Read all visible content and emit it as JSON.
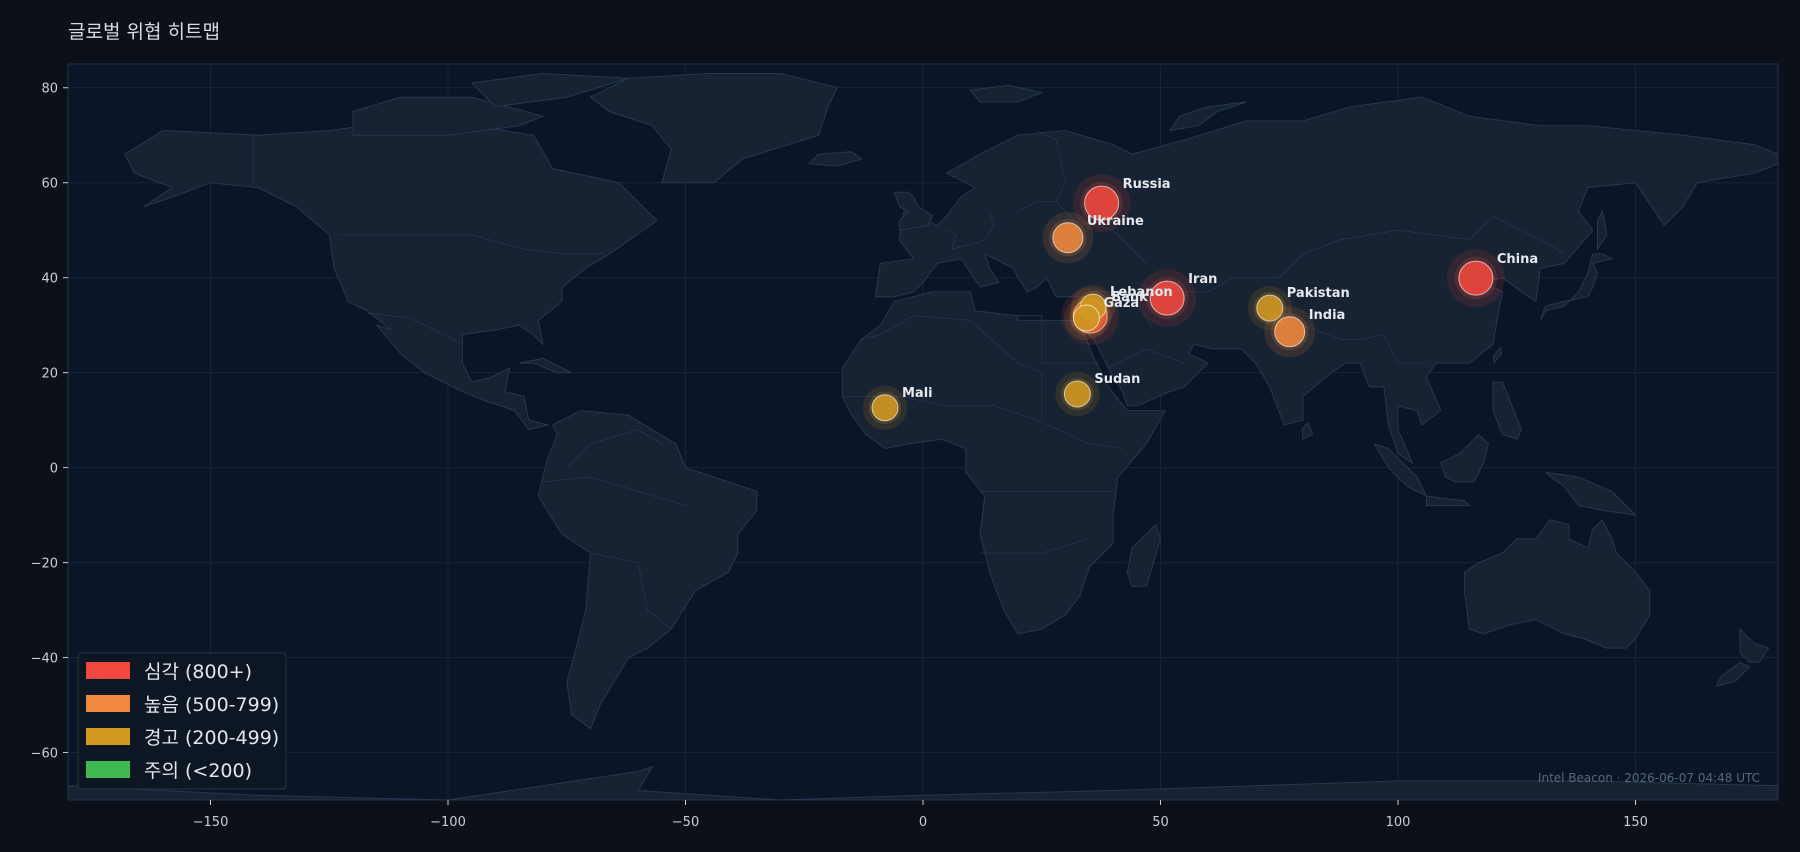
{
  "title": "글로벌 위협 히트맵",
  "credit": "Intel Beacon · 2026-06-07 04:48 UTC",
  "colors": {
    "critical": "#f0483e",
    "high": "#f0883e",
    "warning": "#d29922",
    "caution": "#3fb950",
    "background": "#0c1018",
    "ocean": "#0a1628",
    "land": "#172232"
  },
  "legend": [
    {
      "label": "심각 (800+)",
      "color": "#f0483e"
    },
    {
      "label": "높음 (500-799)",
      "color": "#f0883e"
    },
    {
      "label": "경고 (200-499)",
      "color": "#d29922"
    },
    {
      "label": "주의 (<200)",
      "color": "#3fb950"
    }
  ],
  "chart_data": {
    "type": "scatter",
    "xlim": [
      -180,
      180
    ],
    "ylim": [
      -70,
      85
    ],
    "xticks": [
      -150,
      -100,
      -50,
      0,
      50,
      100,
      150
    ],
    "yticks": [
      80,
      60,
      40,
      20,
      0,
      -20,
      -40,
      -60
    ],
    "grid": true,
    "legend_position": "lower-left",
    "points": [
      {
        "name": "Russia",
        "lon": 37.6,
        "lat": 55.7,
        "level": "critical"
      },
      {
        "name": "Ukraine",
        "lon": 30.5,
        "lat": 48.4,
        "level": "high"
      },
      {
        "name": "China",
        "lon": 116.4,
        "lat": 39.9,
        "level": "critical"
      },
      {
        "name": "Iran",
        "lon": 51.4,
        "lat": 35.7,
        "level": "critical"
      },
      {
        "name": "Bank",
        "lon": 35.2,
        "lat": 31.9,
        "level": "critical"
      },
      {
        "name": "Lebanon",
        "lon": 35.8,
        "lat": 33.8,
        "level": "warning"
      },
      {
        "name": "Gaza",
        "lon": 34.4,
        "lat": 31.5,
        "level": "warning"
      },
      {
        "name": "Pakistan",
        "lon": 73.0,
        "lat": 33.6,
        "level": "warning"
      },
      {
        "name": "India",
        "lon": 77.2,
        "lat": 28.6,
        "level": "high"
      },
      {
        "name": "Sudan",
        "lon": 32.5,
        "lat": 15.5,
        "level": "warning"
      },
      {
        "name": "Mali",
        "lon": -8.0,
        "lat": 12.6,
        "level": "warning"
      }
    ]
  }
}
